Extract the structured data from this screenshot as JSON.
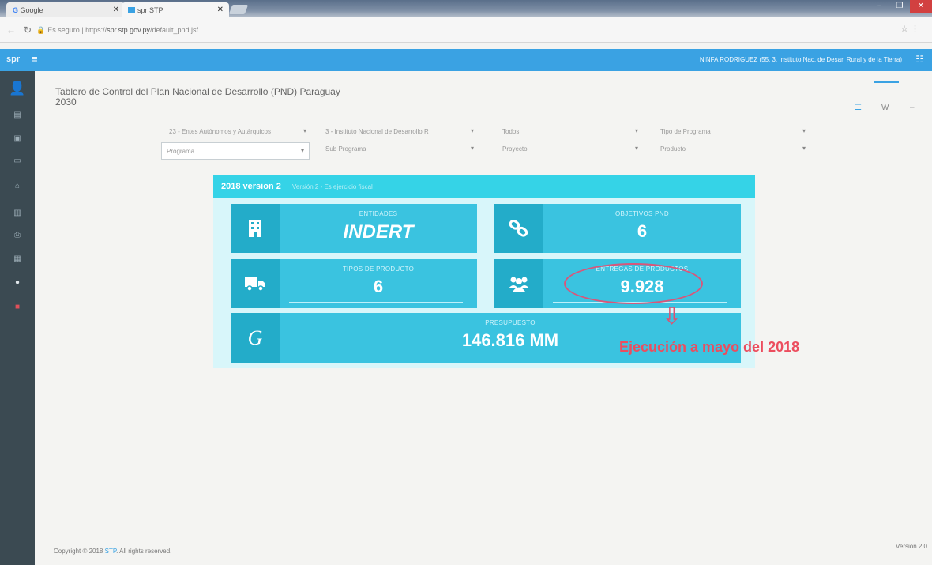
{
  "browser": {
    "tabs": [
      {
        "title": "Google"
      },
      {
        "title": "spr STP"
      }
    ],
    "url_secure": "Es seguro",
    "url_prefix": "https://",
    "url_domain": "spr.stp.gov.py",
    "url_path": "/default_pnd.jsf"
  },
  "app": {
    "brand": "spr",
    "user": "NINFA RODRIGUEZ (55, 3, Instituto Nac. de Desar. Rural y de la Tierra)"
  },
  "header": {
    "title_line1": "Tablero de Control del Plan Nacional de Desarrollo (PND) Paraguay",
    "title_line2": "2030",
    "view_label": "W"
  },
  "filters": {
    "row1": [
      "23 - Entes Autónomos y Autárquicos",
      "3 - Instituto Nacional de Desarrollo R",
      "Todos",
      "Tipo de Programa"
    ],
    "row2": [
      "Programa",
      "Sub Programa",
      "Proyecto",
      "Producto"
    ]
  },
  "dashboard": {
    "panel_title": "2018 version 2",
    "panel_subtitle": "Versión 2 - Es ejercicio fiscal",
    "cards": {
      "entidades": {
        "label": "ENTIDADES",
        "value": "INDERT"
      },
      "objetivos": {
        "label": "OBJETIVOS PND",
        "value": "6"
      },
      "tipos": {
        "label": "TIPOS DE PRODUCTO",
        "value": "6"
      },
      "entregas": {
        "label": "ENTREGAS DE PRODUCTOS",
        "value": "9.928"
      },
      "presupuesto": {
        "label": "PRESUPUESTO",
        "value": "146.816 MM",
        "icon_glyph": "G"
      }
    }
  },
  "annotation": {
    "text": "Ejecución a mayo del 2018",
    "color": "#ec4d5e"
  },
  "footer": {
    "prefix": "Copyright © 2018",
    "link": "STP",
    "suffix": ". All rights reserved.",
    "version": "Version 2.0"
  },
  "colors": {
    "accent": "#3aa2e3",
    "card": "#3ac3e0",
    "card_icon": "#23acc9",
    "sidebar": "#3b4a52"
  }
}
